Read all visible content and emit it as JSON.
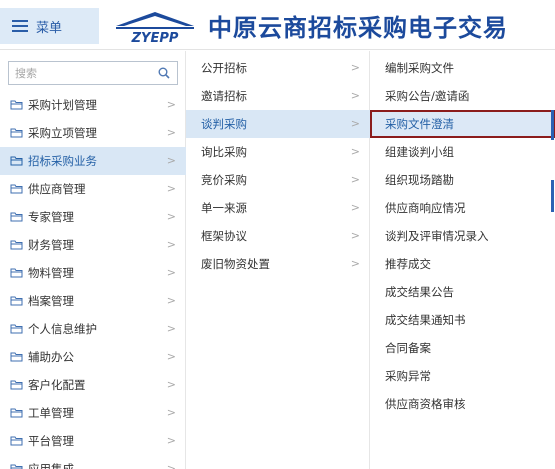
{
  "header": {
    "menu_label": "菜单",
    "logo_text": "ZYEPP",
    "site_title": "中原云商招标采购电子交易"
  },
  "search": {
    "placeholder": "搜索"
  },
  "sidebar": {
    "items": [
      {
        "label": "采购计划管理"
      },
      {
        "label": "采购立项管理"
      },
      {
        "label": "招标采购业务"
      },
      {
        "label": "供应商管理"
      },
      {
        "label": "专家管理"
      },
      {
        "label": "财务管理"
      },
      {
        "label": "物料管理"
      },
      {
        "label": "档案管理"
      },
      {
        "label": "个人信息维护"
      },
      {
        "label": "辅助办公"
      },
      {
        "label": "客户化配置"
      },
      {
        "label": "工单管理"
      },
      {
        "label": "平台管理"
      },
      {
        "label": "应用集成"
      }
    ]
  },
  "submenu": {
    "items": [
      {
        "label": "公开招标"
      },
      {
        "label": "邀请招标"
      },
      {
        "label": "谈判采购"
      },
      {
        "label": "询比采购"
      },
      {
        "label": "竞价采购"
      },
      {
        "label": "单一来源"
      },
      {
        "label": "框架协议"
      },
      {
        "label": "废旧物资处置"
      }
    ]
  },
  "actions": {
    "items": [
      {
        "label": "编制采购文件"
      },
      {
        "label": "采购公告/邀请函"
      },
      {
        "label": "采购文件澄清"
      },
      {
        "label": "组建谈判小组"
      },
      {
        "label": "组织现场踏勘"
      },
      {
        "label": "供应商响应情况"
      },
      {
        "label": "谈判及评审情况录入"
      },
      {
        "label": "推荐成交"
      },
      {
        "label": "成交结果公告"
      },
      {
        "label": "成交结果通知书"
      },
      {
        "label": "合同备案"
      },
      {
        "label": "采购异常"
      },
      {
        "label": "供应商资格审核"
      }
    ]
  },
  "colors": {
    "accent": "#2460a6",
    "active_bg": "#d9e7f5",
    "highlight_border": "#8b1c1c",
    "title": "#1c4a9c"
  }
}
